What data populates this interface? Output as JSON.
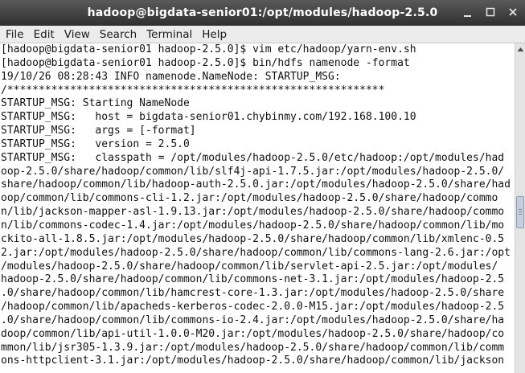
{
  "window": {
    "title": "hadoop@bigdata-senior01:/opt/modules/hadoop-2.5.0",
    "controls": [
      "minimize-icon",
      "maximize-icon",
      "close-icon"
    ]
  },
  "menu": [
    "File",
    "Edit",
    "View",
    "Search",
    "Terminal",
    "Help"
  ],
  "terminal": {
    "lines": [
      "[hadoop@bigdata-senior01 hadoop-2.5.0]$ vim etc/hadoop/yarn-env.sh",
      "[hadoop@bigdata-senior01 hadoop-2.5.0]$ bin/hdfs namenode -format",
      "19/10/26 08:28:43 INFO namenode.NameNode: STARTUP_MSG:",
      "/************************************************************",
      "STARTUP_MSG: Starting NameNode",
      "STARTUP_MSG:   host = bigdata-senior01.chybinmy.com/192.168.100.10",
      "STARTUP_MSG:   args = [-format]",
      "STARTUP_MSG:   version = 2.5.0",
      "STARTUP_MSG:   classpath = /opt/modules/hadoop-2.5.0/etc/hadoop:/opt/modules/had",
      "oop-2.5.0/share/hadoop/common/lib/slf4j-api-1.7.5.jar:/opt/modules/hadoop-2.5.0/",
      "share/hadoop/common/lib/hadoop-auth-2.5.0.jar:/opt/modules/hadoop-2.5.0/share/had",
      "oop/common/lib/commons-cli-1.2.jar:/opt/modules/hadoop-2.5.0/share/hadoop/commo",
      "n/lib/jackson-mapper-asl-1.9.13.jar:/opt/modules/hadoop-2.5.0/share/hadoop/commo",
      "n/lib/commons-codec-1.4.jar:/opt/modules/hadoop-2.5.0/share/hadoop/common/lib/mo",
      "ckito-all-1.8.5.jar:/opt/modules/hadoop-2.5.0/share/hadoop/common/lib/xmlenc-0.5",
      "2.jar:/opt/modules/hadoop-2.5.0/share/hadoop/common/lib/commons-lang-2.6.jar:/opt",
      "/modules/hadoop-2.5.0/share/hadoop/common/lib/servlet-api-2.5.jar:/opt/modules/",
      "hadoop-2.5.0/share/hadoop/common/lib/commons-net-3.1.jar:/opt/modules/hadoop-2.5",
      ".0/share/hadoop/common/lib/hamcrest-core-1.3.jar:/opt/modules/hadoop-2.5.0/share",
      "/hadoop/common/lib/apacheds-kerberos-codec-2.0.0-M15.jar:/opt/modules/hadoop-2.5",
      ".0/share/hadoop/common/lib/commons-io-2.4.jar:/opt/modules/hadoop-2.5.0/share/ha",
      "doop/common/lib/api-util-1.0.0-M20.jar:/opt/modules/hadoop-2.5.0/share/hadoop/co",
      "mmon/lib/jsr305-1.3.9.jar:/opt/modules/hadoop-2.5.0/share/hadoop/common/lib/comm",
      "ons-httpclient-3.1.jar:/opt/modules/hadoop-2.5.0/share/hadoop/common/lib/jackson"
    ]
  },
  "colors": {
    "titlebar": "#3c3c3c",
    "menubar": "#ececec",
    "terminal_bg": "#ffffff",
    "terminal_fg": "#111111",
    "scroll_thumb": "#c6cfdb"
  }
}
